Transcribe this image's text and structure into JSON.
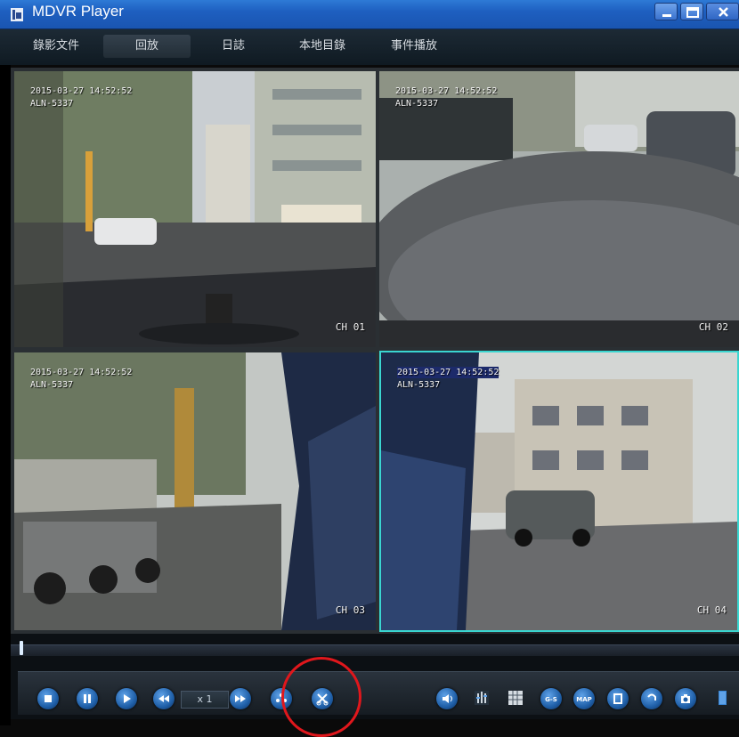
{
  "window": {
    "title": "MDVR Player",
    "titlebar_color": "#1e5fc0"
  },
  "menu": {
    "items": [
      {
        "label": "錄影文件"
      },
      {
        "label": "回放"
      },
      {
        "label": "日誌"
      },
      {
        "label": "本地目錄"
      },
      {
        "label": "事件播放"
      }
    ],
    "active_index": 1
  },
  "cameras": [
    {
      "timestamp": "2015-03-27 14:52:52",
      "plate": "ALN-5337",
      "channel": "CH 01"
    },
    {
      "timestamp": "2015-03-27 14:52:52",
      "plate": "ALN-5337",
      "channel": "CH 02"
    },
    {
      "timestamp": "2015-03-27 14:52:52",
      "plate": "ALN-5337",
      "channel": "CH 03"
    },
    {
      "timestamp": "2015-03-27 14:52:52",
      "plate": "ALN-5337",
      "channel": "CH 04",
      "selected": true
    }
  ],
  "selected_border_color": "#3ad6d0",
  "timeline": {
    "progress": 0.005
  },
  "controls": {
    "speed_label": "x 1",
    "buttons": [
      "stop-icon",
      "pause-icon",
      "play-icon",
      "rewind-icon",
      "fast-forward-icon",
      "step-icon",
      "clip-icon",
      "volume-icon",
      "equalizer-icon",
      "grid-icon",
      "gsensor-icon",
      "map-icon",
      "window-icon",
      "refresh-icon",
      "camera-icon",
      "file-icon"
    ],
    "gsensor_label": "G-S",
    "map_label": "MAP"
  },
  "annotation_color": "#e0171c"
}
